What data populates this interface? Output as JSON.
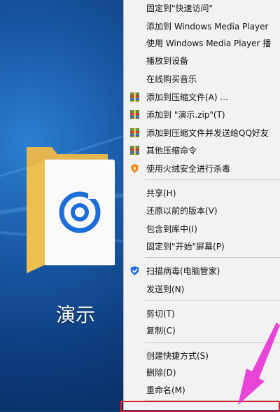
{
  "desktop": {
    "folder_label": "演示"
  },
  "menu": {
    "items": [
      {
        "label": "固定到\"快速访问\"",
        "icon": ""
      },
      {
        "label": "添加到 Windows Media Player",
        "icon": ""
      },
      {
        "label": "使用 Windows Media Player 播",
        "icon": ""
      },
      {
        "label": "播放到设备",
        "icon": ""
      },
      {
        "label": "在线购买音乐",
        "icon": ""
      },
      {
        "label": "添加到压缩文件(A) ...",
        "icon": "archive-icon"
      },
      {
        "label": "添加到 \"演示.zip\"(T)",
        "icon": "archive-icon"
      },
      {
        "label": "添加到压缩文件并发送给QQ好友",
        "icon": "archive-icon"
      },
      {
        "label": "其他压缩命令",
        "icon": "archive-icon"
      },
      {
        "label": "使用火绒安全进行杀毒",
        "icon": "huorong-shield-icon"
      },
      {
        "label": "共享(H)",
        "icon": ""
      },
      {
        "label": "还原以前的版本(V)",
        "icon": ""
      },
      {
        "label": "包含到库中(I)",
        "icon": ""
      },
      {
        "label": "固定到\"开始\"屏幕(P)",
        "icon": ""
      },
      {
        "label": "扫描病毒(电脑管家)",
        "icon": "tencent-pc-manager-icon"
      },
      {
        "label": "发送到(N)",
        "icon": ""
      },
      {
        "label": "剪切(T)",
        "icon": ""
      },
      {
        "label": "复制(C)",
        "icon": ""
      },
      {
        "label": "创建快捷方式(S)",
        "icon": ""
      },
      {
        "label": "删除(D)",
        "icon": ""
      },
      {
        "label": "重命名(M)",
        "icon": ""
      }
    ]
  },
  "colors": {
    "highlight": "#e01d2e",
    "arrow": "#e83ad6",
    "menu_bg": "#f2f2f2"
  }
}
